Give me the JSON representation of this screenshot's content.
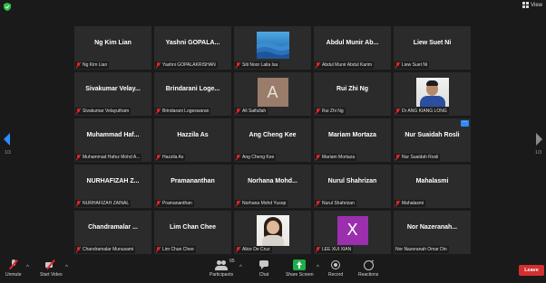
{
  "top": {
    "view_label": "View"
  },
  "pagination": {
    "left": "1/3",
    "right": "1/3"
  },
  "tiles": [
    {
      "big_name": "Ng Kim Lian",
      "label": "Ng Kim Lian"
    },
    {
      "big_name": "Yashni GOPALA...",
      "label": "Yashni GOPALAKRISHAN"
    },
    {
      "big_name": "",
      "label": "Siti Noor Laila Isa"
    },
    {
      "big_name": "Abdul Munir Ab...",
      "label": "Abdul Munir Abdul Karim"
    },
    {
      "big_name": "Liew Suet Ni",
      "label": "Liew Suet Ni"
    },
    {
      "big_name": "Sivakumar Velay...",
      "label": "Sivakumar Velayutham"
    },
    {
      "big_name": "Brindarani Loge...",
      "label": "Brindarani Logeswaran"
    },
    {
      "big_name": "",
      "label": "Ali Saifullah",
      "avatar_letter": "A"
    },
    {
      "big_name": "Rui Zhi Ng",
      "label": "Rui Zhi Ng"
    },
    {
      "big_name": "",
      "label": "Dr ANG KIANG LONG"
    },
    {
      "big_name": "Muhammad Haf...",
      "label": "Muhammad Hafez Mohd A..."
    },
    {
      "big_name": "Hazzila As",
      "label": "Hazzila As"
    },
    {
      "big_name": "Ang Cheng Kee",
      "label": "Ang Cheng Kee"
    },
    {
      "big_name": "Mariam Mortaza",
      "label": "Mariam Mortaza"
    },
    {
      "big_name": "Nur Suaidah Rosli",
      "label": "Nur Suaidah Rosli",
      "more": "···"
    },
    {
      "big_name": "NURHAFIZAH Z...",
      "label": "NURHAFIZAH ZAINAL"
    },
    {
      "big_name": "Pramananthan",
      "label": "Pramananthan"
    },
    {
      "big_name": "Norhana Mohd...",
      "label": "Norhana Mohd Yusop"
    },
    {
      "big_name": "Nurul Shahrizan",
      "label": "Nurul Shahrizan"
    },
    {
      "big_name": "Mahalasmi",
      "label": "Mahalasmi"
    },
    {
      "big_name": "Chandramalar ...",
      "label": "Chandramalar Munusami"
    },
    {
      "big_name": "Lim Chan Chee",
      "label": "Lim Chan Chee"
    },
    {
      "big_name": "",
      "label": "Alice De Cruz"
    },
    {
      "big_name": "",
      "label": "LEE XUI XIAN",
      "avatar_letter": "X"
    },
    {
      "big_name": "Nor Nazeranah...",
      "label": "Nor Nazeranah Omar Din"
    }
  ],
  "toolbar": {
    "unmute": "Unmute",
    "start_video": "Start Video",
    "participants": "Participants",
    "participants_count": "65",
    "chat": "Chat",
    "share_screen": "Share Screen",
    "record": "Record",
    "reactions": "Reactions",
    "leave": "Leave",
    "caret": "^"
  },
  "colors": {
    "background": "#1a1a1a",
    "tile": "#2b2b2b",
    "accent_blue": "#2d8cff",
    "share_green": "#1fae4a",
    "leave_red": "#d32f2f",
    "muted_red": "#e02828"
  }
}
